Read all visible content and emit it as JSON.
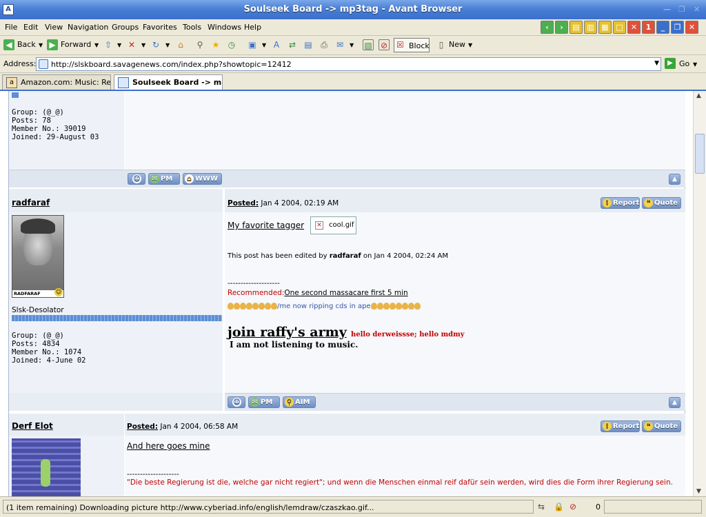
{
  "window": {
    "title": "Soulseek Board -> mp3tag - Avant Browser",
    "app_icon": "A",
    "controls": [
      "minimize",
      "maximize",
      "close"
    ]
  },
  "menu": [
    "File",
    "Edit",
    "View",
    "Navigation",
    "Groups",
    "Favorites",
    "Tools",
    "Windows",
    "Help"
  ],
  "toolbar": {
    "back": "Back",
    "forward": "Forward",
    "block": "Block",
    "new": "New"
  },
  "address": {
    "label": "Address:",
    "url": "http://slskboard.savagenews.com/index.php?showtopic=12412",
    "go": "Go"
  },
  "tabs": [
    {
      "label": "Amazon.com: Music: Re...",
      "active": false
    },
    {
      "label": "Soulseek Board -> mp...",
      "active": true
    }
  ],
  "posts": [
    {
      "info": "Group: (@_@)\nPosts: 78\nMember No.: 39019\nJoined: 29-August 03",
      "buttons": [
        "PM",
        "WWW"
      ]
    },
    {
      "author": "radfaraf",
      "posted_label": "Posted:",
      "posted_date": "Jan 4 2004, 02:19 AM",
      "report": "Report",
      "quote": "Quote",
      "avatar_caption": "RADFARAF",
      "member_title": "Slsk-Desolator",
      "info": "Group: (@_@)\nPosts: 4834\nMember No.: 1074\nJoined: 4-June 02",
      "body_link": "My favorite tagger",
      "image_name": "cool.gif",
      "edited_prefix": "This post has been edited by",
      "edited_by": "radfaraf",
      "edited_suffix": "on Jan 4 2004, 02:24 AM",
      "sig_separator": "--------------------",
      "recommended_label": "Recommended:",
      "recommended_link": "One second massacare first 5 min",
      "ripping": "/me now ripping cds in ape",
      "army": "join raffy's army",
      "hello": "hello derweissse; hello mdmy",
      "not_listening": "I am not listening to music.",
      "buttons": [
        "PM",
        "AIM"
      ]
    },
    {
      "author": "Derf Elot",
      "posted_label": "Posted:",
      "posted_date": "Jan 4 2004, 06:58 AM",
      "report": "Report",
      "quote": "Quote",
      "body_link": "And here goes mine",
      "sig_separator": "--------------------",
      "quote_text": "\"Die beste Regierung ist die, welche gar nicht regiert\"; und wenn die Menschen einmal reif dafür sein werden, wird dies die Form ihrer Regierung sein."
    }
  ],
  "status": {
    "text": "(1 item remaining) Downloading picture http://www.cyberiad.info/english/lemdraw/czaszkao.gif...",
    "count": "0"
  },
  "colors": {
    "accent": "#3b6fcc",
    "red_text": "#c00000",
    "bar": "#dfe6ef"
  }
}
